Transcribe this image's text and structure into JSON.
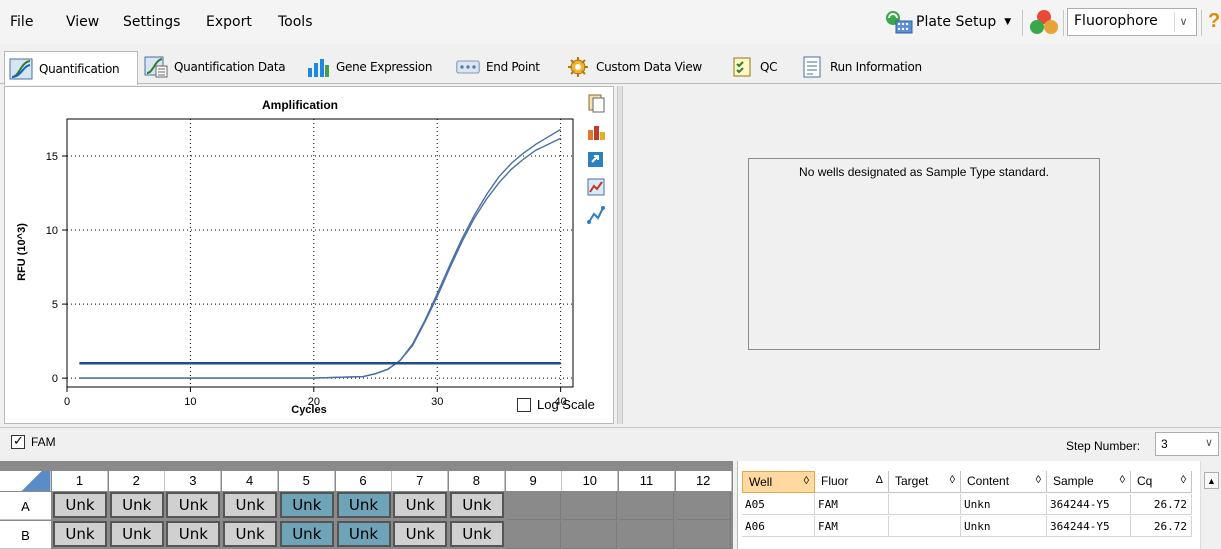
{
  "menu": {
    "file": "File",
    "view": "View",
    "settings": "Settings",
    "export": "Export",
    "tools": "Tools"
  },
  "toolbar": {
    "plate_setup": "Plate Setup",
    "fluor_select": "Fluorophore",
    "help": "?"
  },
  "tabs": [
    {
      "label": "Quantification",
      "active": true
    },
    {
      "label": "Quantification Data",
      "active": false
    },
    {
      "label": "Gene Expression",
      "active": false
    },
    {
      "label": "End Point",
      "active": false
    },
    {
      "label": "Custom Data View",
      "active": false
    },
    {
      "label": "QC",
      "active": false
    },
    {
      "label": "Run Information",
      "active": false
    }
  ],
  "chart_data": {
    "type": "line",
    "title": "Amplification",
    "xlabel": "Cycles",
    "ylabel": "RFU (10^3)",
    "xlim": [
      0,
      41
    ],
    "ylim": [
      -0.6,
      17.5
    ],
    "xticks": [
      0,
      10,
      20,
      30,
      40
    ],
    "yticks": [
      0,
      5,
      10,
      15
    ],
    "grid": true,
    "threshold": 1.0,
    "series": [
      {
        "color": "#4a6fa5",
        "x": [
          1,
          5,
          10,
          15,
          20,
          24,
          25,
          26,
          27,
          28,
          29,
          30,
          31,
          32,
          33,
          34,
          35,
          36,
          37,
          38,
          39,
          40
        ],
        "y": [
          0.0,
          0.0,
          0.0,
          0.0,
          0.0,
          0.1,
          0.3,
          0.6,
          1.2,
          2.3,
          3.9,
          5.7,
          7.6,
          9.4,
          11.0,
          12.4,
          13.6,
          14.5,
          15.2,
          15.8,
          16.3,
          16.8
        ]
      },
      {
        "color": "#4a6fa5",
        "x": [
          1,
          5,
          10,
          15,
          20,
          24,
          25,
          26,
          27,
          28,
          29,
          30,
          31,
          32,
          33,
          34,
          35,
          36,
          37,
          38,
          39,
          40
        ],
        "y": [
          0.0,
          0.0,
          0.0,
          0.0,
          0.0,
          0.1,
          0.3,
          0.6,
          1.2,
          2.2,
          3.8,
          5.5,
          7.4,
          9.2,
          10.8,
          12.1,
          13.2,
          14.1,
          14.8,
          15.4,
          15.8,
          16.2
        ]
      }
    ]
  },
  "chart_options": {
    "log_scale_label": "Log Scale",
    "log_scale_checked": false
  },
  "std_curve": {
    "message": "No wells designated as Sample Type standard."
  },
  "fam_bar": {
    "label": "FAM",
    "checked": true,
    "step_label": "Step Number:",
    "step_value": "3"
  },
  "plate": {
    "columns": [
      "1",
      "2",
      "3",
      "4",
      "5",
      "6",
      "7",
      "8",
      "9",
      "10",
      "11",
      "12"
    ],
    "rows": [
      {
        "label": "A",
        "wells": [
          "Unk",
          "Unk",
          "Unk",
          "Unk",
          "Unk",
          "Unk",
          "Unk",
          "Unk"
        ]
      },
      {
        "label": "B",
        "wells": [
          "Unk",
          "Unk",
          "Unk",
          "Unk",
          "Unk",
          "Unk",
          "Unk",
          "Unk"
        ]
      }
    ],
    "selected_cols": [
      5,
      6
    ]
  },
  "table": {
    "headers": [
      "Well",
      "Fluor",
      "Target",
      "Content",
      "Sample",
      "Cq"
    ],
    "header_sort_icons": [
      "◊",
      "Δ",
      "◊",
      "◊",
      "◊",
      "◊"
    ],
    "rows": [
      [
        "A05",
        "FAM",
        "",
        "Unkn",
        "364244-Y5",
        "26.72"
      ],
      [
        "A06",
        "FAM",
        "",
        "Unkn",
        "364244-Y5",
        "26.72"
      ]
    ]
  }
}
